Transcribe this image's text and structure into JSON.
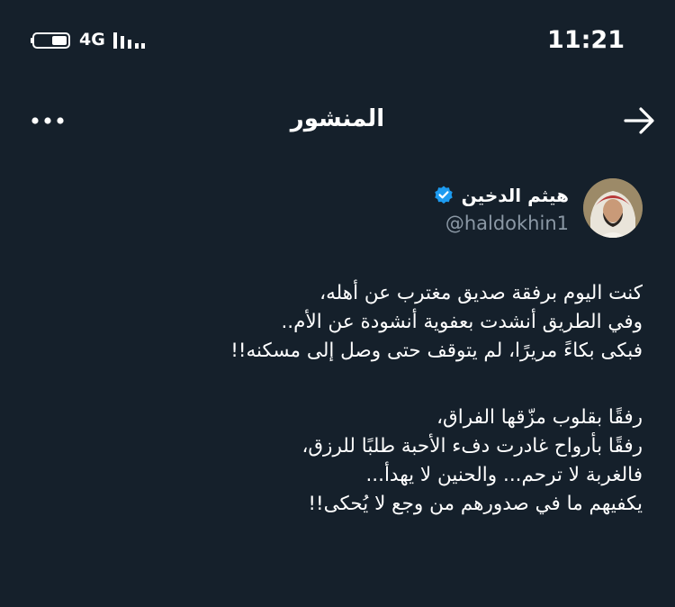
{
  "status_bar": {
    "network": "4G",
    "time": "11:21"
  },
  "header": {
    "title": "المنشور",
    "back_icon": "arrow-right-icon",
    "more_icon": "more-dots-icon"
  },
  "author": {
    "display_name": "هيثم الدخين",
    "handle": "@haldokhin1",
    "verified_color": "#1d9bf0"
  },
  "tweet": {
    "paragraph1": [
      "كنت اليوم برفقة صديق مغترب عن أهله،",
      "وفي الطريق أنشدت بعفوية أنشودة عن الأم..",
      "فبكى بكاءً مريرًا، لم يتوقف حتى وصل إلى مسكنه!!"
    ],
    "paragraph2": [
      "رفقًا بقلوب مزّقها الفراق،",
      "رفقًا بأرواح غادرت دفء الأحبة طلبًا للرزق،",
      "فالغربة لا ترحم... والحنين لا يهدأ...",
      "يكفيهم ما في صدورهم من وجع لا يُحكى!!"
    ]
  },
  "colors": {
    "background": "#15202b",
    "text": "#ffffff",
    "secondary_text": "#8b98a5",
    "accent": "#1d9bf0"
  }
}
